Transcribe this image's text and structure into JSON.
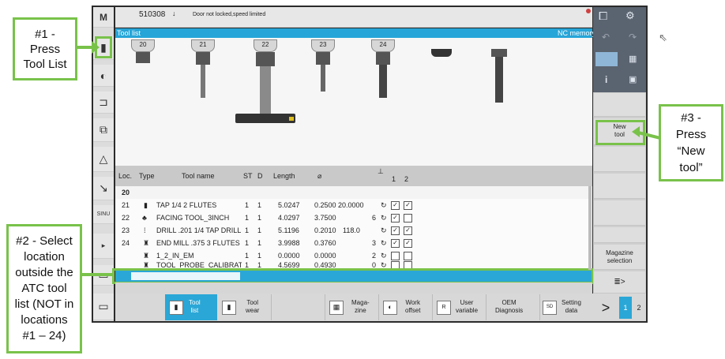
{
  "header": {
    "channel": "510308",
    "alarm": "Door not locked,speed limited"
  },
  "titlebar": {
    "left": "Tool list",
    "right": "NC memory"
  },
  "magazine_numbers": [
    "20",
    "21",
    "22",
    "23",
    "24"
  ],
  "table": {
    "headers": {
      "loc": "Loc.",
      "type": "Type",
      "name": "Tool name",
      "st": "ST",
      "d": "D",
      "length": "Length",
      "dia": "⌀",
      "c1": "1",
      "c2": "2"
    },
    "selected_loc": "20",
    "rows": [
      {
        "loc": "21",
        "name": "TAP 1/4 2 FLUTES",
        "st": "1",
        "d": "1",
        "length": "5.0247",
        "dia": "0.2500",
        "extra": "20.0000",
        "n": "",
        "c1": "✓",
        "c2": "✓"
      },
      {
        "loc": "22",
        "name": "FACING TOOL_3INCH",
        "st": "1",
        "d": "1",
        "length": "4.0297",
        "dia": "3.7500",
        "extra": "",
        "n": "6",
        "c1": "✓",
        "c2": ""
      },
      {
        "loc": "23",
        "name": "DRILL .201 1/4 TAP DRILL",
        "st": "1",
        "d": "1",
        "length": "5.1196",
        "dia": "0.2010",
        "extra": "118.0",
        "n": "",
        "c1": "✓",
        "c2": "✓"
      },
      {
        "loc": "24",
        "name": "END MILL .375 3 FLUTES",
        "st": "1",
        "d": "1",
        "length": "3.9988",
        "dia": "0.3760",
        "extra": "",
        "n": "3",
        "c1": "✓",
        "c2": "✓"
      },
      {
        "loc": "",
        "name": "1_2_IN_EM",
        "st": "1",
        "d": "1",
        "length": "0.0000",
        "dia": "0.0000",
        "extra": "",
        "n": "2",
        "c1": "",
        "c2": ""
      },
      {
        "loc": "",
        "name": "TOOL_PROBE_CALIBRATIOI",
        "st": "1",
        "d": "1",
        "length": "4.5699",
        "dia": "0.4930",
        "extra": "",
        "n": "0",
        "c1": "",
        "c2": ""
      }
    ]
  },
  "right_softkeys": {
    "new_tool": "New\ntool",
    "magazine": "Magazine\nselection",
    "more": "≣>"
  },
  "bottom_softkeys": [
    {
      "label": "Tool\nlist"
    },
    {
      "label": "Tool\nwear"
    },
    {
      "label": "Maga-\nzine"
    },
    {
      "label": "Work\noffset"
    },
    {
      "label": "User\nvariable"
    },
    {
      "label": "OEM\nDiagnosis"
    },
    {
      "label": "Setting\ndata"
    }
  ],
  "pager": {
    "arrow": ">",
    "p1": "1",
    "p2": "2"
  },
  "callouts": {
    "c1": "#1 -\nPress\nTool List",
    "c2": "#2 - Select\nlocation\noutside the\nATC tool\nlist (NOT in\nlocations\n#1 – 24)",
    "c3": "#3 -\nPress\n“New\ntool”"
  },
  "colors": {
    "accent": "#26a5d8",
    "highlight": "#79c24a",
    "selected_row": "#2aa7d6"
  }
}
